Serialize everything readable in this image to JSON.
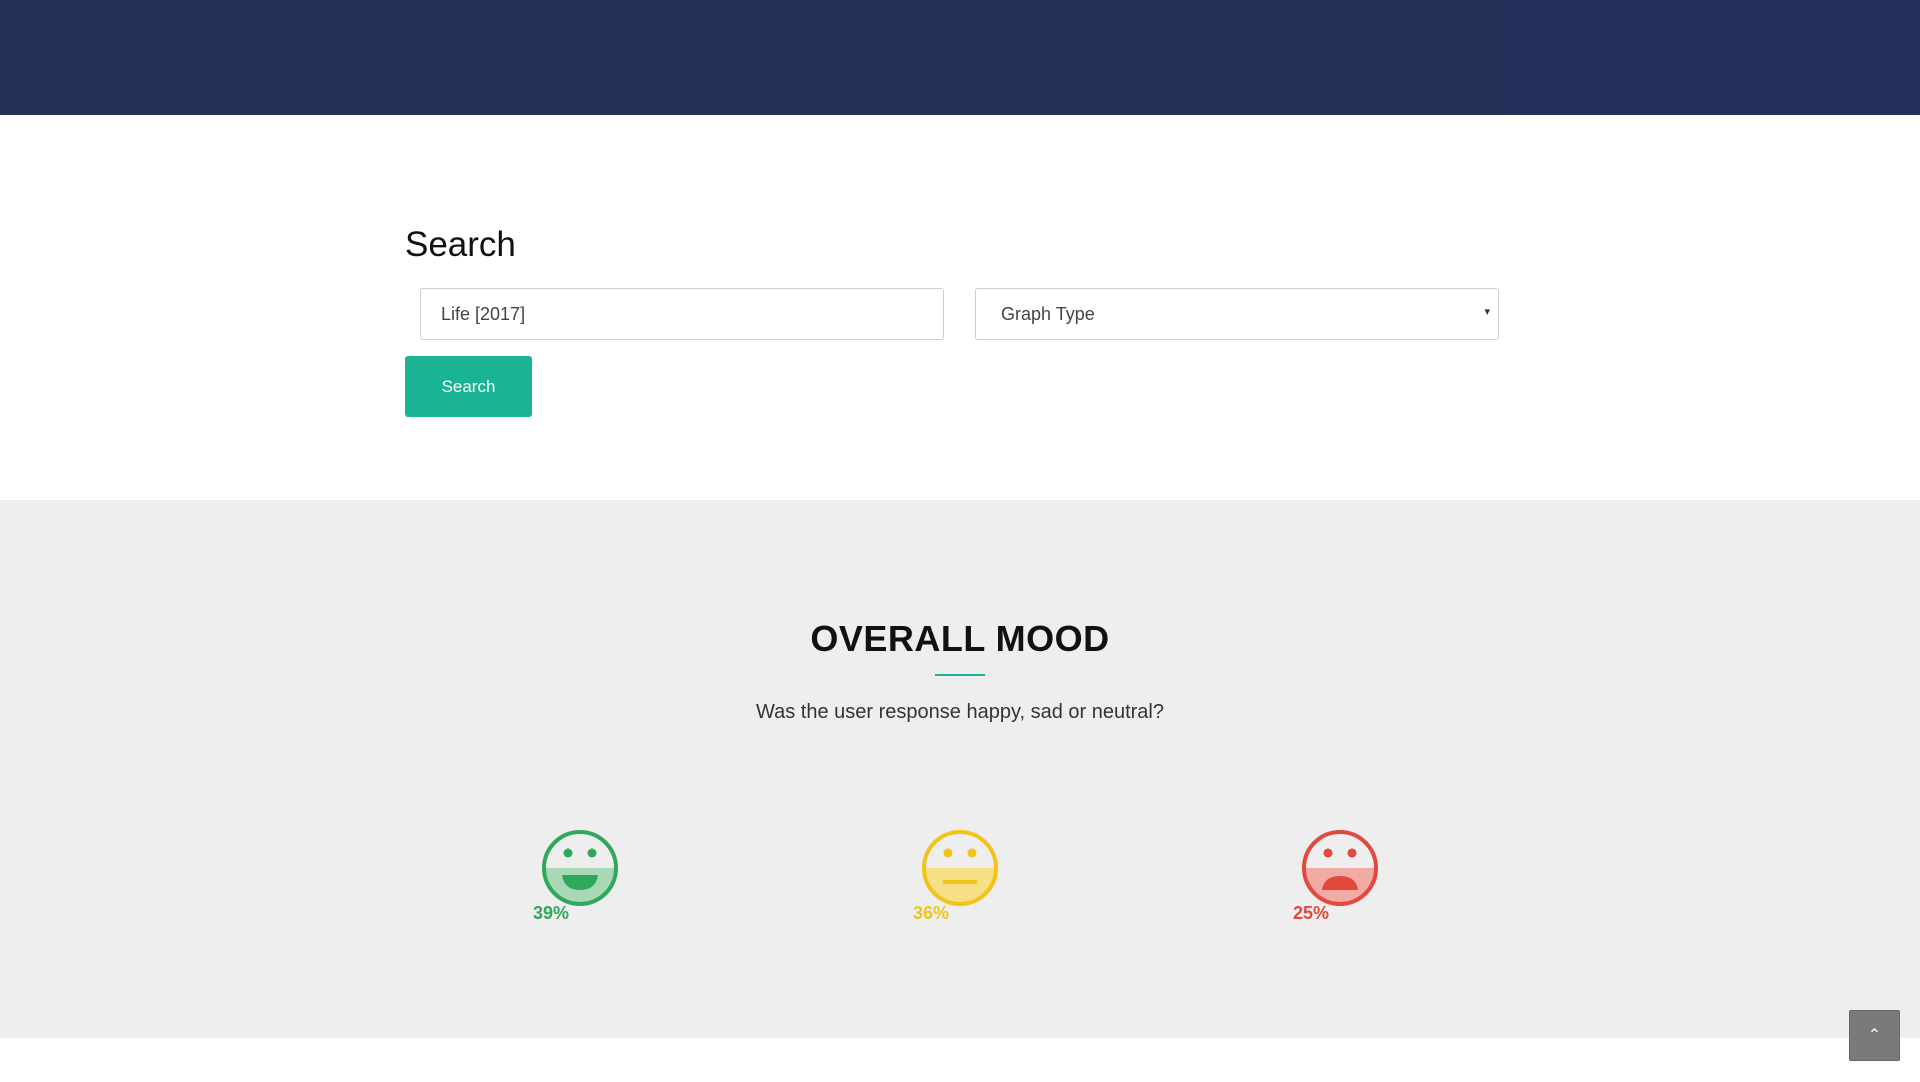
{
  "search": {
    "title": "Search",
    "query_value": "Life [2017]",
    "graph_type_label": "Graph Type",
    "button_label": "Search"
  },
  "mood": {
    "title": "OVERALL MOOD",
    "subtitle": "Was the user response happy, sad or neutral?",
    "items": [
      {
        "name": "happy",
        "percent_label": "39%",
        "value": 39,
        "color": "#2ea95a",
        "light": "#a8d8b6"
      },
      {
        "name": "neutral",
        "percent_label": "36%",
        "value": 36,
        "color": "#f2c318",
        "light": "#f7df86"
      },
      {
        "name": "sad",
        "percent_label": "25%",
        "value": 25,
        "color": "#e2483d",
        "light": "#f2aaa4"
      }
    ]
  },
  "colors": {
    "header": "#243157",
    "accent": "#1ab394",
    "section_bg": "#eeeeee"
  },
  "icons": {
    "scroll_top": "chevron-up-icon"
  }
}
